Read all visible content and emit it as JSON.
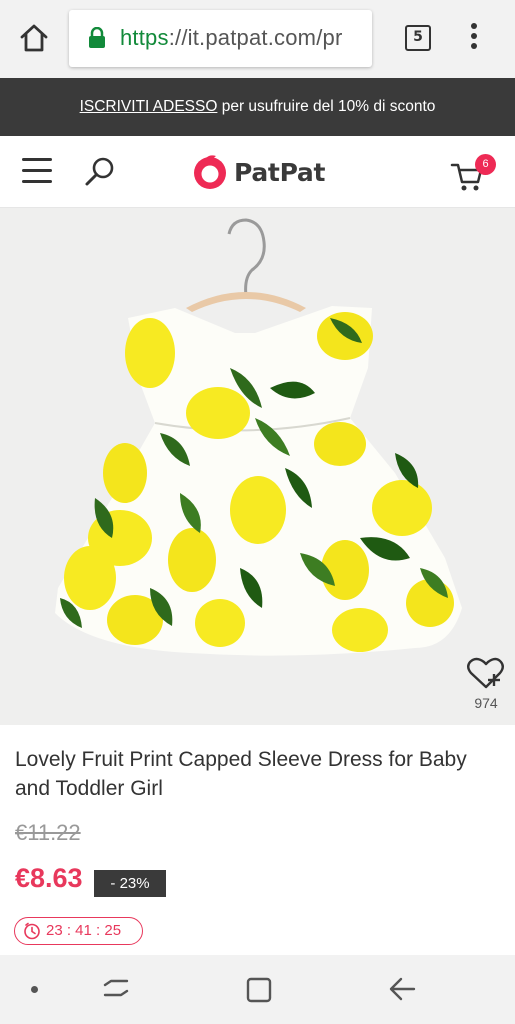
{
  "browser": {
    "url_scheme": "https",
    "url_rest": "://it.patpat.com/pr",
    "tab_count": "5",
    "icons": [
      "home-icon",
      "lock-icon",
      "tabs-icon",
      "more-vert-icon"
    ]
  },
  "promo": {
    "link_text": "ISCRIVITI ADESSO",
    "rest_text": " per usufruire del 10% di sconto"
  },
  "header": {
    "logo_text": "PatPat",
    "cart_count": "6",
    "icons": [
      "menu-icon",
      "search-icon",
      "patpat-logo-icon",
      "cart-icon"
    ],
    "brand_color": "#ee2a55"
  },
  "product": {
    "favorite_count": "974",
    "title": "Lovely Fruit Print Capped Sleeve Dress for Baby and Toddler Girl",
    "original_price": "€11.22",
    "sale_price": "€8.63",
    "discount": "- 23%",
    "countdown": "23 : 41 : 25",
    "price_color": "#e8385c"
  },
  "system_nav": {
    "icons": [
      "dot-icon",
      "recents-icon",
      "home-square-icon",
      "back-arrow-icon"
    ]
  }
}
